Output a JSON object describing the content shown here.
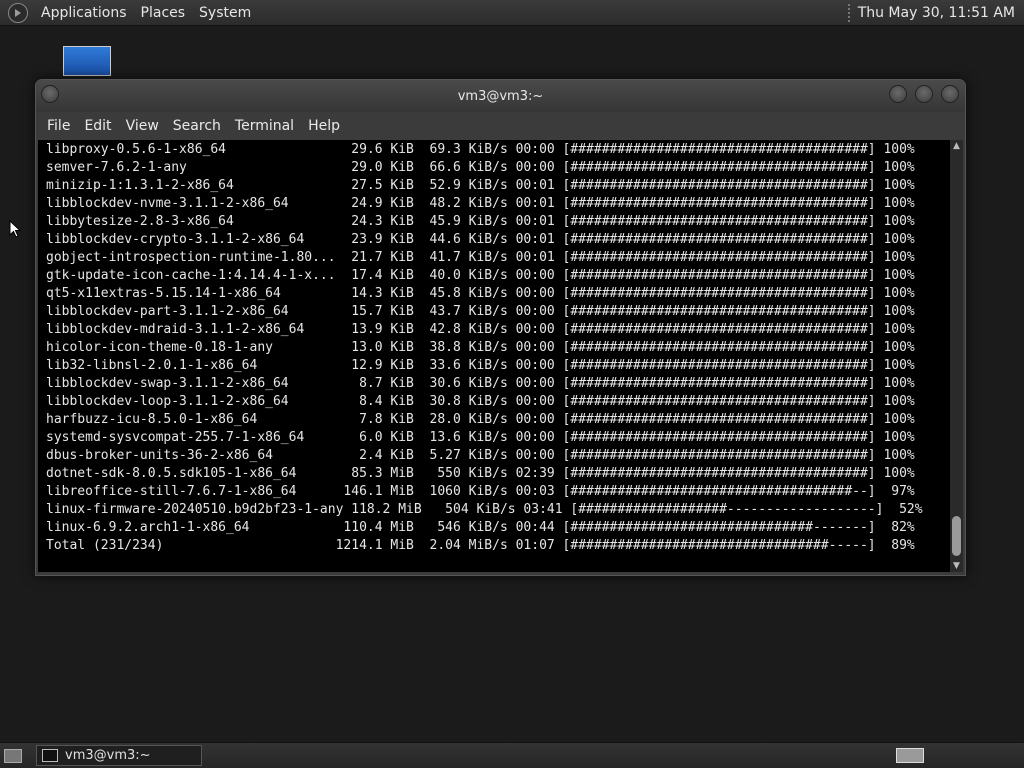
{
  "top_panel": {
    "menus": [
      "Applications",
      "Places",
      "System"
    ],
    "clock": "Thu May 30, 11:51 AM"
  },
  "window": {
    "title": "vm3@vm3:~",
    "menu": [
      "File",
      "Edit",
      "View",
      "Search",
      "Terminal",
      "Help"
    ]
  },
  "terminal": {
    "lines": [
      "libproxy-0.5.6-1-x86_64                29.6 KiB  69.3 KiB/s 00:00 [######################################] 100%",
      "semver-7.6.2-1-any                     29.0 KiB  66.6 KiB/s 00:00 [######################################] 100%",
      "minizip-1:1.3.1-2-x86_64               27.5 KiB  52.9 KiB/s 00:01 [######################################] 100%",
      "libblockdev-nvme-3.1.1-2-x86_64        24.9 KiB  48.2 KiB/s 00:01 [######################################] 100%",
      "libbytesize-2.8-3-x86_64               24.3 KiB  45.9 KiB/s 00:01 [######################################] 100%",
      "libblockdev-crypto-3.1.1-2-x86_64      23.9 KiB  44.6 KiB/s 00:01 [######################################] 100%",
      "gobject-introspection-runtime-1.80...  21.7 KiB  41.7 KiB/s 00:01 [######################################] 100%",
      "gtk-update-icon-cache-1:4.14.4-1-x...  17.4 KiB  40.0 KiB/s 00:00 [######################################] 100%",
      "qt5-x11extras-5.15.14-1-x86_64         14.3 KiB  45.8 KiB/s 00:00 [######################################] 100%",
      "libblockdev-part-3.1.1-2-x86_64        15.7 KiB  43.7 KiB/s 00:00 [######################################] 100%",
      "libblockdev-mdraid-3.1.1-2-x86_64      13.9 KiB  42.8 KiB/s 00:00 [######################################] 100%",
      "hicolor-icon-theme-0.18-1-any          13.0 KiB  38.8 KiB/s 00:00 [######################################] 100%",
      "lib32-libnsl-2.0.1-1-x86_64            12.9 KiB  33.6 KiB/s 00:00 [######################################] 100%",
      "libblockdev-swap-3.1.1-2-x86_64         8.7 KiB  30.6 KiB/s 00:00 [######################################] 100%",
      "libblockdev-loop-3.1.1-2-x86_64         8.4 KiB  30.8 KiB/s 00:00 [######################################] 100%",
      "harfbuzz-icu-8.5.0-1-x86_64             7.8 KiB  28.0 KiB/s 00:00 [######################################] 100%",
      "systemd-sysvcompat-255.7-1-x86_64       6.0 KiB  13.6 KiB/s 00:00 [######################################] 100%",
      "dbus-broker-units-36-2-x86_64           2.4 KiB  5.27 KiB/s 00:00 [######################################] 100%",
      "dotnet-sdk-8.0.5.sdk105-1-x86_64       85.3 MiB   550 KiB/s 02:39 [######################################] 100%",
      "libreoffice-still-7.6.7-1-x86_64      146.1 MiB  1060 KiB/s 00:03 [####################################--]  97%",
      "linux-firmware-20240510.b9d2bf23-1-any 118.2 MiB   504 KiB/s 03:41 [###################-------------------]  52%",
      "linux-6.9.2.arch1-1-x86_64            110.4 MiB   546 KiB/s 00:44 [###############################-------]  82%",
      "Total (231/234)                      1214.1 MiB  2.04 MiB/s 01:07 [#################################-----]  89%"
    ]
  },
  "taskbar": {
    "task_label": "vm3@vm3:~"
  }
}
